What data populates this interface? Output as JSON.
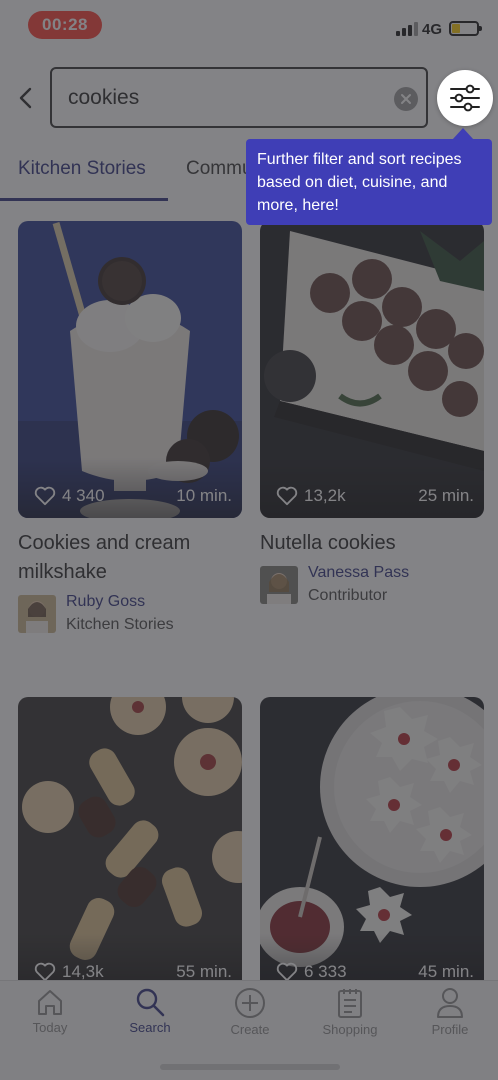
{
  "status_bar": {
    "time": "00:28",
    "network": "4G"
  },
  "search": {
    "query": "cookies"
  },
  "tabs": [
    {
      "label": "Kitchen Stories",
      "active": true
    },
    {
      "label": "Commu",
      "active": false
    }
  ],
  "tooltip": {
    "text": "Further filter and sort recipes based on diet, cuisine, and more, here!"
  },
  "recipes": [
    {
      "title": "Cookies and cream milkshake",
      "likes": "4 340",
      "duration": "10 min.",
      "author_name": "Ruby Goss",
      "author_role": "Kitchen Stories"
    },
    {
      "title": "Nutella cookies",
      "likes": "13,2k",
      "duration": "25 min.",
      "author_name": "Vanessa Pass",
      "author_role": "Contributor"
    },
    {
      "title": "",
      "likes": "14,3k",
      "duration": "55 min."
    },
    {
      "title": "",
      "likes": "6 333",
      "duration": "45 min."
    }
  ],
  "bottom_nav": [
    {
      "label": "Today",
      "icon": "home-icon",
      "active": false
    },
    {
      "label": "Search",
      "icon": "search-icon",
      "active": true
    },
    {
      "label": "Create",
      "icon": "plus-circle-icon",
      "active": false
    },
    {
      "label": "Shopping",
      "icon": "shopping-list-icon",
      "active": false
    },
    {
      "label": "Profile",
      "icon": "person-icon",
      "active": false
    }
  ],
  "colors": {
    "accent": "#2a2f7d",
    "tooltip": "#3f3eb6",
    "recording_pill": "#ff3b30",
    "battery": "#ffcc00"
  }
}
